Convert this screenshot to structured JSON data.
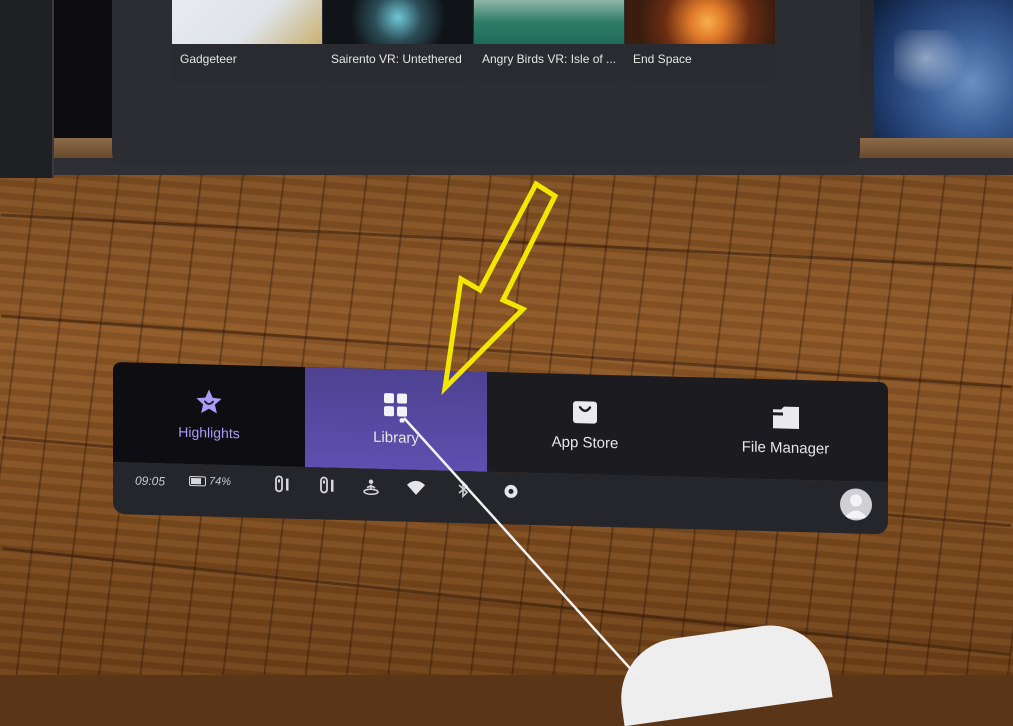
{
  "scene": {
    "cards": [
      {
        "label": "Gadgeteer",
        "thumb_colors": [
          "#dfe4ea",
          "#c9b070"
        ]
      },
      {
        "label": "Sairento VR: Untethered",
        "thumb_colors": [
          "#101418",
          "#6ec7d6"
        ]
      },
      {
        "label": "Angry Birds VR: Isle of ...",
        "thumb_colors": [
          "#1f6b5a",
          "#8fb4a6"
        ]
      },
      {
        "label": "End Space",
        "thumb_colors": [
          "#3a1d0f",
          "#e07a2a"
        ]
      }
    ]
  },
  "menu": {
    "tabs": [
      {
        "label": "Highlights",
        "icon": "star-smile-icon",
        "selected": false
      },
      {
        "label": "Library",
        "icon": "grid-icon",
        "selected": true
      },
      {
        "label": "App Store",
        "icon": "shopping-bag-icon",
        "selected": false
      },
      {
        "label": "File Manager",
        "icon": "folder-icon",
        "selected": false
      }
    ]
  },
  "status": {
    "time": "09:05",
    "battery_percent": "74%",
    "battery_level": 0.74,
    "icons": [
      "controller-left-icon",
      "controller-right-icon",
      "guardian-icon",
      "wifi-icon",
      "bluetooth-icon",
      "settings-icon"
    ]
  },
  "colors": {
    "accent": "#a99cf5",
    "selected_tab": "#5a4aa8",
    "arrow": "#f3e600"
  }
}
